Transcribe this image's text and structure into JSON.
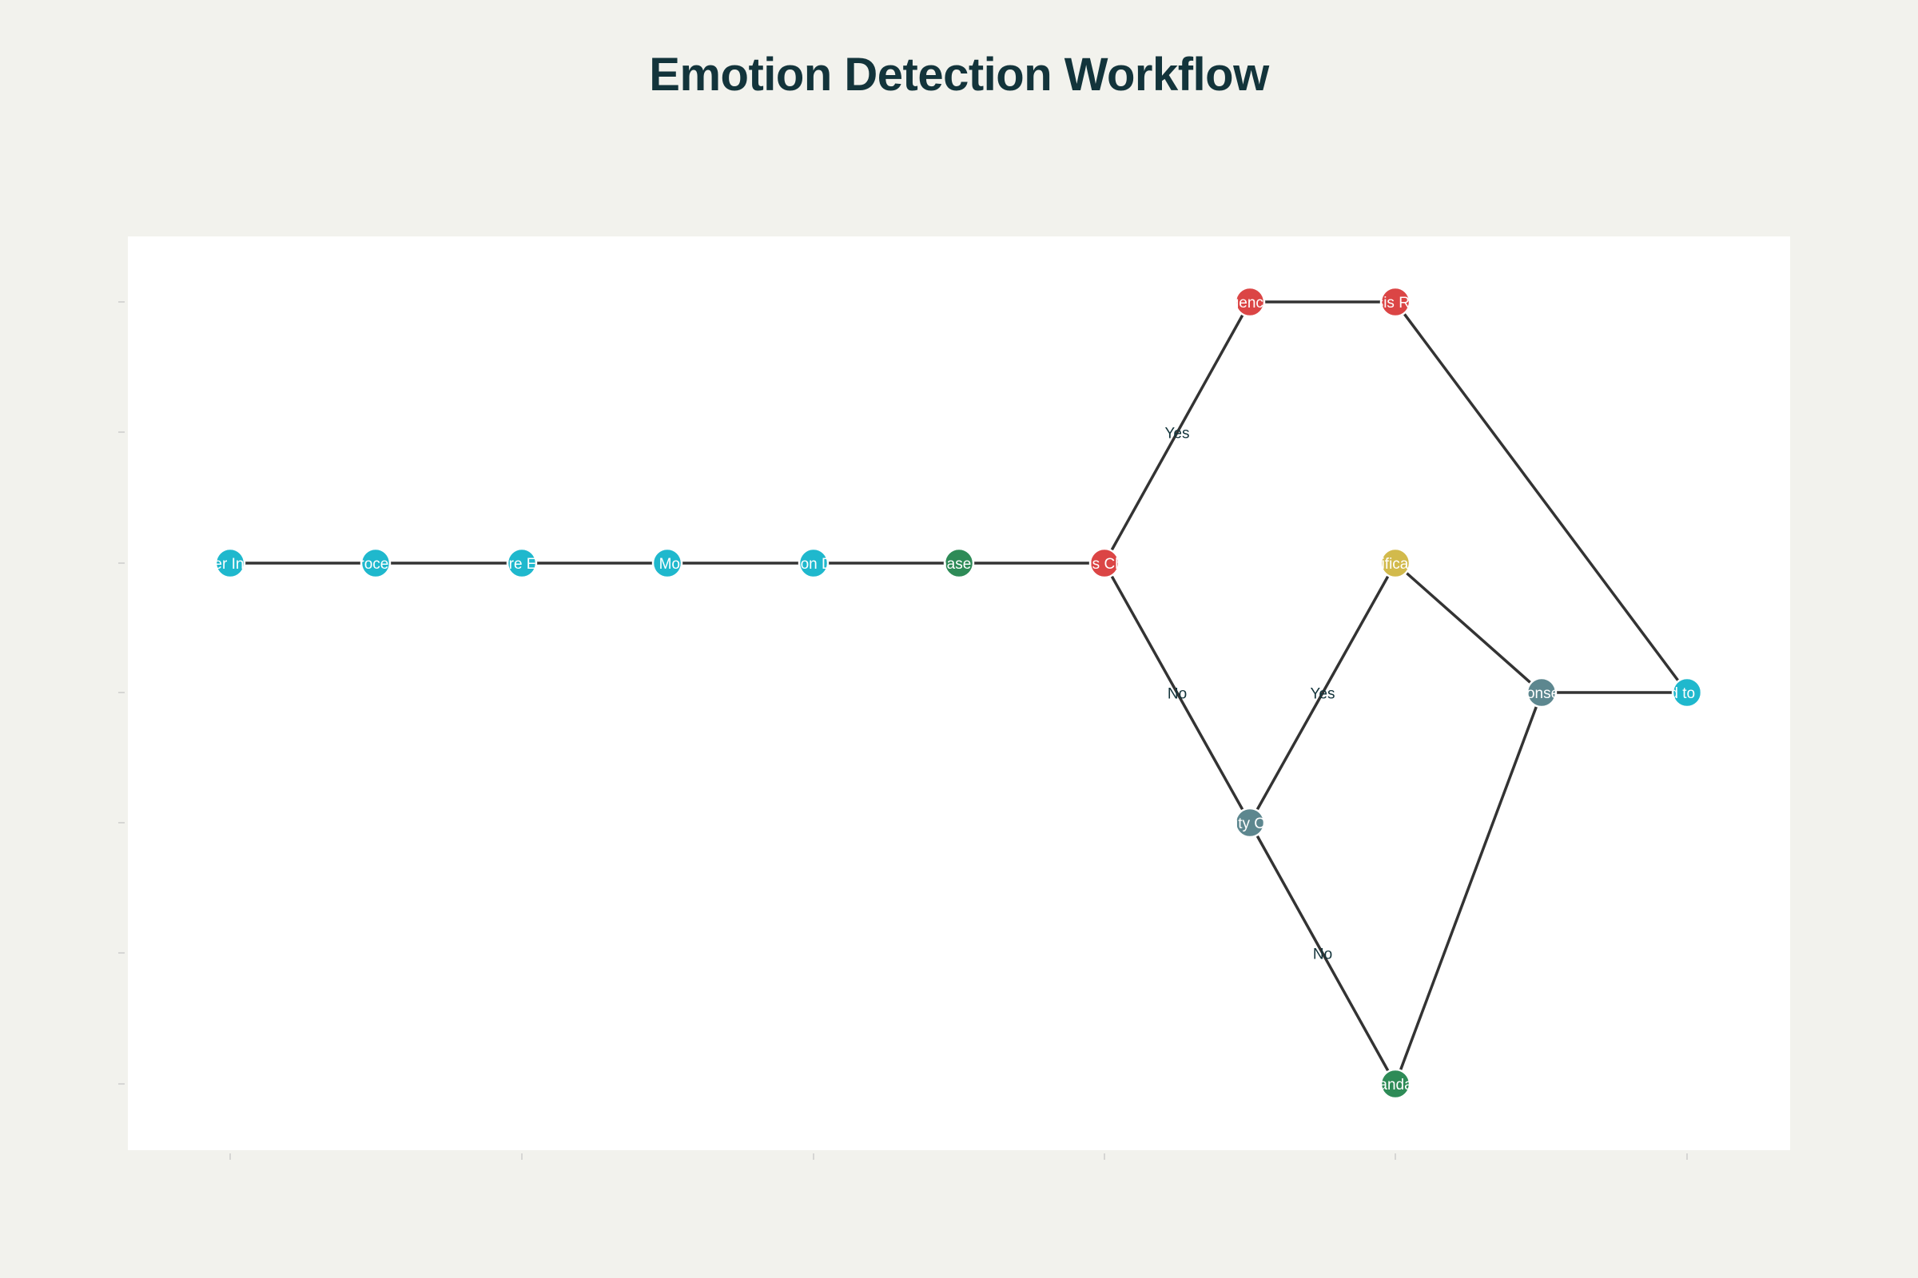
{
  "title": "Emotion Detection Workflow",
  "colors": {
    "page_bg": "#f2f2ed",
    "plot_bg": "#ffffff",
    "title": "#13343b",
    "edge": "#333333",
    "tick": "#cccccc",
    "node_border": "#ffffff",
    "cyan": "#1fb8cd",
    "green": "#2e8b57",
    "red": "#db4545",
    "slate": "#5d878f",
    "gold": "#d2ba4c"
  },
  "nodes": [
    {
      "id": "user-input",
      "label": "User Input",
      "color": "cyan"
    },
    {
      "id": "preprocessing",
      "label": "Preprocessing",
      "color": "cyan"
    },
    {
      "id": "feature-extract",
      "label": "Feature Extract",
      "color": "cyan"
    },
    {
      "id": "ml-model",
      "label": "ML Model",
      "color": "cyan"
    },
    {
      "id": "emotion-detect",
      "label": "Emotion Detect",
      "color": "cyan"
    },
    {
      "id": "database-store",
      "label": "Database Store",
      "color": "green"
    },
    {
      "id": "crisis-check",
      "label": "Crisis Check",
      "color": "red"
    },
    {
      "id": "emergency-alert",
      "label": "Emergency Alert",
      "color": "red"
    },
    {
      "id": "crisis-resp",
      "label": "Crisis Resp",
      "color": "red"
    },
    {
      "id": "priority-check",
      "label": "Priority Check",
      "color": "slate"
    },
    {
      "id": "notification",
      "label": "Notification",
      "color": "gold"
    },
    {
      "id": "standard",
      "label": "Standard",
      "color": "green"
    },
    {
      "id": "response-gen",
      "label": "Response Gen",
      "color": "slate"
    },
    {
      "id": "send-to-user",
      "label": "Send to User",
      "color": "cyan"
    }
  ],
  "edges": [
    {
      "from": "user-input",
      "to": "preprocessing",
      "label": ""
    },
    {
      "from": "preprocessing",
      "to": "feature-extract",
      "label": ""
    },
    {
      "from": "feature-extract",
      "to": "ml-model",
      "label": ""
    },
    {
      "from": "ml-model",
      "to": "emotion-detect",
      "label": ""
    },
    {
      "from": "emotion-detect",
      "to": "database-store",
      "label": ""
    },
    {
      "from": "database-store",
      "to": "crisis-check",
      "label": ""
    },
    {
      "from": "crisis-check",
      "to": "emergency-alert",
      "label": "Yes"
    },
    {
      "from": "emergency-alert",
      "to": "crisis-resp",
      "label": ""
    },
    {
      "from": "crisis-resp",
      "to": "send-to-user",
      "label": ""
    },
    {
      "from": "crisis-check",
      "to": "priority-check",
      "label": "No"
    },
    {
      "from": "priority-check",
      "to": "notification",
      "label": "Yes"
    },
    {
      "from": "priority-check",
      "to": "standard",
      "label": "No"
    },
    {
      "from": "notification",
      "to": "response-gen",
      "label": ""
    },
    {
      "from": "standard",
      "to": "response-gen",
      "label": ""
    },
    {
      "from": "response-gen",
      "to": "send-to-user",
      "label": ""
    }
  ]
}
